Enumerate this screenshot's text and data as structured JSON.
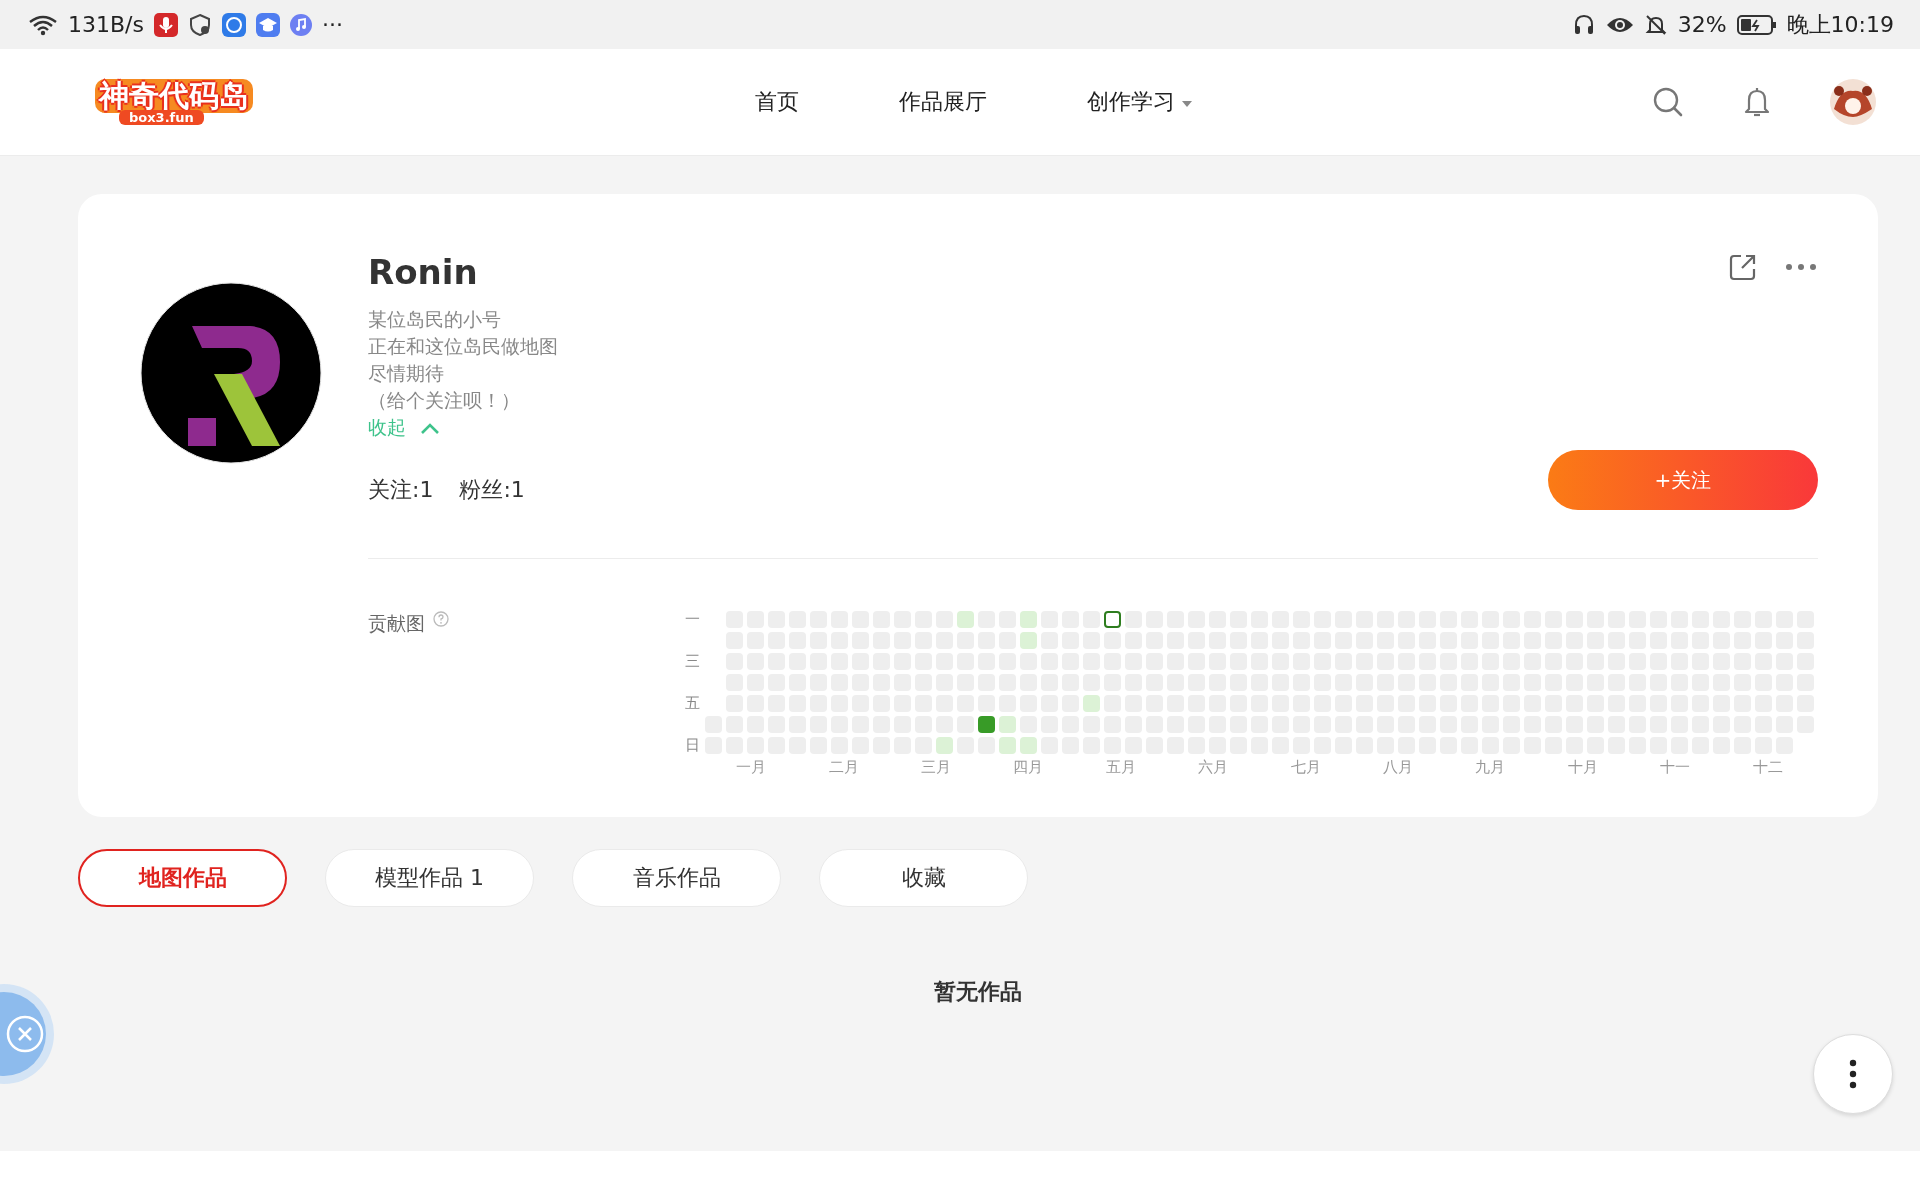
{
  "status_bar": {
    "net_speed": "131B/s",
    "more": "···",
    "battery": "32%",
    "time": "晚上10:19"
  },
  "header": {
    "logo": {
      "title": "神奇代码岛",
      "subtitle": "box3.fun"
    },
    "nav": [
      {
        "label": "首页",
        "dropdown": false
      },
      {
        "label": "作品展厅",
        "dropdown": false
      },
      {
        "label": "创作学习",
        "dropdown": true
      }
    ]
  },
  "profile": {
    "name": "Ronin",
    "bio": [
      "某位岛民的小号",
      "正在和这位岛民做地图",
      "尽情期待",
      "（给个关注呗！）"
    ],
    "toggle": "收起",
    "expanded": true,
    "stats": [
      {
        "label": "关注:1"
      },
      {
        "label": "粉丝:1"
      }
    ],
    "follow_button": "+关注"
  },
  "contribution": {
    "title": "贡献图",
    "day_labels": [
      "一",
      "三",
      "五",
      "日"
    ],
    "months": [
      "一月",
      "二月",
      "三月",
      "四月",
      "五月",
      "六月",
      "七月",
      "八月",
      "九月",
      "十月",
      "十一",
      "十二"
    ],
    "weeks": [
      {
        "days": [
          {
            "color": "#eeeeee",
            "today": false
          },
          {
            "color": "#eeeeee",
            "today": false
          }
        ]
      },
      {
        "days": [
          {
            "color": "#eeeeee",
            "today": false
          },
          {
            "color": "#eeeeee",
            "today": false
          },
          {
            "color": "#eeeeee",
            "today": false
          },
          {
            "color": "#eeeeee",
            "today": false
          },
          {
            "color": "#eeeeee",
            "today": false
          },
          {
            "color": "#eeeeee",
            "today": false
          },
          {
            "color": "#eeeeee",
            "today": false
          }
        ]
      },
      {
        "days": [
          {
            "color": "#eeeeee",
            "today": false
          },
          {
            "color": "#eeeeee",
            "today": false
          },
          {
            "color": "#eeeeee",
            "today": false
          },
          {
            "color": "#eeeeee",
            "today": false
          },
          {
            "color": "#eeeeee",
            "today": false
          },
          {
            "color": "#eeeeee",
            "today": false
          },
          {
            "color": "#eeeeee",
            "today": false
          }
        ]
      },
      {
        "days": [
          {
            "color": "#eeeeee",
            "today": false
          },
          {
            "color": "#eeeeee",
            "today": false
          },
          {
            "color": "#eeeeee",
            "today": false
          },
          {
            "color": "#eeeeee",
            "today": false
          },
          {
            "color": "#eeeeee",
            "today": false
          },
          {
            "color": "#eeeeee",
            "today": false
          },
          {
            "color": "#eeeeee",
            "today": false
          }
        ]
      },
      {
        "days": [
          {
            "color": "#eeeeee",
            "today": false
          },
          {
            "color": "#eeeeee",
            "today": false
          },
          {
            "color": "#eeeeee",
            "today": false
          },
          {
            "color": "#eeeeee",
            "today": false
          },
          {
            "color": "#eeeeee",
            "today": false
          },
          {
            "color": "#eeeeee",
            "today": false
          },
          {
            "color": "#eeeeee",
            "today": false
          }
        ]
      },
      {
        "days": [
          {
            "color": "#eeeeee",
            "today": false
          },
          {
            "color": "#eeeeee",
            "today": false
          },
          {
            "color": "#eeeeee",
            "today": false
          },
          {
            "color": "#eeeeee",
            "today": false
          },
          {
            "color": "#eeeeee",
            "today": false
          },
          {
            "color": "#eeeeee",
            "today": false
          },
          {
            "color": "#eeeeee",
            "today": false
          }
        ]
      },
      {
        "days": [
          {
            "color": "#eeeeee",
            "today": false
          },
          {
            "color": "#eeeeee",
            "today": false
          },
          {
            "color": "#eeeeee",
            "today": false
          },
          {
            "color": "#eeeeee",
            "today": false
          },
          {
            "color": "#eeeeee",
            "today": false
          },
          {
            "color": "#eeeeee",
            "today": false
          },
          {
            "color": "#eeeeee",
            "today": false
          }
        ]
      },
      {
        "days": [
          {
            "color": "#eeeeee",
            "today": false
          },
          {
            "color": "#eeeeee",
            "today": false
          },
          {
            "color": "#eeeeee",
            "today": false
          },
          {
            "color": "#eeeeee",
            "today": false
          },
          {
            "color": "#eeeeee",
            "today": false
          },
          {
            "color": "#eeeeee",
            "today": false
          },
          {
            "color": "#eeeeee",
            "today": false
          }
        ]
      },
      {
        "days": [
          {
            "color": "#eeeeee",
            "today": false
          },
          {
            "color": "#eeeeee",
            "today": false
          },
          {
            "color": "#eeeeee",
            "today": false
          },
          {
            "color": "#eeeeee",
            "today": false
          },
          {
            "color": "#eeeeee",
            "today": false
          },
          {
            "color": "#eeeeee",
            "today": false
          },
          {
            "color": "#eeeeee",
            "today": false
          }
        ]
      },
      {
        "days": [
          {
            "color": "#eeeeee",
            "today": false
          },
          {
            "color": "#eeeeee",
            "today": false
          },
          {
            "color": "#eeeeee",
            "today": false
          },
          {
            "color": "#eeeeee",
            "today": false
          },
          {
            "color": "#eeeeee",
            "today": false
          },
          {
            "color": "#eeeeee",
            "today": false
          },
          {
            "color": "#eeeeee",
            "today": false
          }
        ]
      },
      {
        "days": [
          {
            "color": "#eeeeee",
            "today": false
          },
          {
            "color": "#eeeeee",
            "today": false
          },
          {
            "color": "#eeeeee",
            "today": false
          },
          {
            "color": "#eeeeee",
            "today": false
          },
          {
            "color": "#eeeeee",
            "today": false
          },
          {
            "color": "#eeeeee",
            "today": false
          },
          {
            "color": "#eeeeee",
            "today": false
          }
        ]
      },
      {
        "days": [
          {
            "color": "#eeeeee",
            "today": false
          },
          {
            "color": "#eeeeee",
            "today": false
          },
          {
            "color": "#eeeeee",
            "today": false
          },
          {
            "color": "#eeeeee",
            "today": false
          },
          {
            "color": "#eeeeee",
            "today": false
          },
          {
            "color": "#eeeeee",
            "today": false
          },
          {
            "color": "#dcf2d6",
            "today": false
          }
        ]
      },
      {
        "days": [
          {
            "color": "#dcf2d6",
            "today": false
          },
          {
            "color": "#eeeeee",
            "today": false
          },
          {
            "color": "#eeeeee",
            "today": false
          },
          {
            "color": "#eeeeee",
            "today": false
          },
          {
            "color": "#eeeeee",
            "today": false
          },
          {
            "color": "#eeeeee",
            "today": false
          },
          {
            "color": "#eeeeee",
            "today": false
          }
        ]
      },
      {
        "days": [
          {
            "color": "#eeeeee",
            "today": false
          },
          {
            "color": "#eeeeee",
            "today": false
          },
          {
            "color": "#eeeeee",
            "today": false
          },
          {
            "color": "#eeeeee",
            "today": false
          },
          {
            "color": "#eeeeee",
            "today": false
          },
          {
            "color": "#389b27",
            "today": false
          },
          {
            "color": "#eeeeee",
            "today": false
          }
        ]
      },
      {
        "days": [
          {
            "color": "#eeeeee",
            "today": false
          },
          {
            "color": "#eeeeee",
            "today": false
          },
          {
            "color": "#eeeeee",
            "today": false
          },
          {
            "color": "#eeeeee",
            "today": false
          },
          {
            "color": "#eeeeee",
            "today": false
          },
          {
            "color": "#dcf2d6",
            "today": false
          },
          {
            "color": "#dcf2d6",
            "today": false
          }
        ]
      },
      {
        "days": [
          {
            "color": "#dcf2d6",
            "today": false
          },
          {
            "color": "#dcf2d6",
            "today": false
          },
          {
            "color": "#eeeeee",
            "today": false
          },
          {
            "color": "#eeeeee",
            "today": false
          },
          {
            "color": "#eeeeee",
            "today": false
          },
          {
            "color": "#eeeeee",
            "today": false
          },
          {
            "color": "#dcf2d6",
            "today": false
          }
        ]
      },
      {
        "days": [
          {
            "color": "#eeeeee",
            "today": false
          },
          {
            "color": "#eeeeee",
            "today": false
          },
          {
            "color": "#eeeeee",
            "today": false
          },
          {
            "color": "#eeeeee",
            "today": false
          },
          {
            "color": "#eeeeee",
            "today": false
          },
          {
            "color": "#eeeeee",
            "today": false
          },
          {
            "color": "#eeeeee",
            "today": false
          }
        ]
      },
      {
        "days": [
          {
            "color": "#eeeeee",
            "today": false
          },
          {
            "color": "#eeeeee",
            "today": false
          },
          {
            "color": "#eeeeee",
            "today": false
          },
          {
            "color": "#eeeeee",
            "today": false
          },
          {
            "color": "#eeeeee",
            "today": false
          },
          {
            "color": "#eeeeee",
            "today": false
          },
          {
            "color": "#eeeeee",
            "today": false
          }
        ]
      },
      {
        "days": [
          {
            "color": "#eeeeee",
            "today": false
          },
          {
            "color": "#eeeeee",
            "today": false
          },
          {
            "color": "#eeeeee",
            "today": false
          },
          {
            "color": "#eeeeee",
            "today": false
          },
          {
            "color": "#dcf2d6",
            "today": false
          },
          {
            "color": "#eeeeee",
            "today": false
          },
          {
            "color": "#eeeeee",
            "today": false
          }
        ]
      },
      {
        "days": [
          {
            "color": "#ffffff",
            "today": true
          },
          {
            "color": "#eeeeee",
            "today": false
          },
          {
            "color": "#eeeeee",
            "today": false
          },
          {
            "color": "#eeeeee",
            "today": false
          },
          {
            "color": "#eeeeee",
            "today": false
          },
          {
            "color": "#eeeeee",
            "today": false
          },
          {
            "color": "#eeeeee",
            "today": false
          }
        ]
      },
      {
        "days": [
          {
            "color": "#eeeeee",
            "today": false
          },
          {
            "color": "#eeeeee",
            "today": false
          },
          {
            "color": "#eeeeee",
            "today": false
          },
          {
            "color": "#eeeeee",
            "today": false
          },
          {
            "color": "#eeeeee",
            "today": false
          },
          {
            "color": "#eeeeee",
            "today": false
          },
          {
            "color": "#eeeeee",
            "today": false
          }
        ]
      },
      {
        "days": [
          {
            "color": "#eeeeee",
            "today": false
          },
          {
            "color": "#eeeeee",
            "today": false
          },
          {
            "color": "#eeeeee",
            "today": false
          },
          {
            "color": "#eeeeee",
            "today": false
          },
          {
            "color": "#eeeeee",
            "today": false
          },
          {
            "color": "#eeeeee",
            "today": false
          },
          {
            "color": "#eeeeee",
            "today": false
          }
        ]
      },
      {
        "days": [
          {
            "color": "#eeeeee",
            "today": false
          },
          {
            "color": "#eeeeee",
            "today": false
          },
          {
            "color": "#eeeeee",
            "today": false
          },
          {
            "color": "#eeeeee",
            "today": false
          },
          {
            "color": "#eeeeee",
            "today": false
          },
          {
            "color": "#eeeeee",
            "today": false
          },
          {
            "color": "#eeeeee",
            "today": false
          }
        ]
      },
      {
        "days": [
          {
            "color": "#eeeeee",
            "today": false
          },
          {
            "color": "#eeeeee",
            "today": false
          },
          {
            "color": "#eeeeee",
            "today": false
          },
          {
            "color": "#eeeeee",
            "today": false
          },
          {
            "color": "#eeeeee",
            "today": false
          },
          {
            "color": "#eeeeee",
            "today": false
          },
          {
            "color": "#eeeeee",
            "today": false
          }
        ]
      },
      {
        "days": [
          {
            "color": "#eeeeee",
            "today": false
          },
          {
            "color": "#eeeeee",
            "today": false
          },
          {
            "color": "#eeeeee",
            "today": false
          },
          {
            "color": "#eeeeee",
            "today": false
          },
          {
            "color": "#eeeeee",
            "today": false
          },
          {
            "color": "#eeeeee",
            "today": false
          },
          {
            "color": "#eeeeee",
            "today": false
          }
        ]
      },
      {
        "days": [
          {
            "color": "#eeeeee",
            "today": false
          },
          {
            "color": "#eeeeee",
            "today": false
          },
          {
            "color": "#eeeeee",
            "today": false
          },
          {
            "color": "#eeeeee",
            "today": false
          },
          {
            "color": "#eeeeee",
            "today": false
          },
          {
            "color": "#eeeeee",
            "today": false
          },
          {
            "color": "#eeeeee",
            "today": false
          }
        ]
      },
      {
        "days": [
          {
            "color": "#eeeeee",
            "today": false
          },
          {
            "color": "#eeeeee",
            "today": false
          },
          {
            "color": "#eeeeee",
            "today": false
          },
          {
            "color": "#eeeeee",
            "today": false
          },
          {
            "color": "#eeeeee",
            "today": false
          },
          {
            "color": "#eeeeee",
            "today": false
          },
          {
            "color": "#eeeeee",
            "today": false
          }
        ]
      },
      {
        "days": [
          {
            "color": "#eeeeee",
            "today": false
          },
          {
            "color": "#eeeeee",
            "today": false
          },
          {
            "color": "#eeeeee",
            "today": false
          },
          {
            "color": "#eeeeee",
            "today": false
          },
          {
            "color": "#eeeeee",
            "today": false
          },
          {
            "color": "#eeeeee",
            "today": false
          },
          {
            "color": "#eeeeee",
            "today": false
          }
        ]
      },
      {
        "days": [
          {
            "color": "#eeeeee",
            "today": false
          },
          {
            "color": "#eeeeee",
            "today": false
          },
          {
            "color": "#eeeeee",
            "today": false
          },
          {
            "color": "#eeeeee",
            "today": false
          },
          {
            "color": "#eeeeee",
            "today": false
          },
          {
            "color": "#eeeeee",
            "today": false
          },
          {
            "color": "#eeeeee",
            "today": false
          }
        ]
      },
      {
        "days": [
          {
            "color": "#eeeeee",
            "today": false
          },
          {
            "color": "#eeeeee",
            "today": false
          },
          {
            "color": "#eeeeee",
            "today": false
          },
          {
            "color": "#eeeeee",
            "today": false
          },
          {
            "color": "#eeeeee",
            "today": false
          },
          {
            "color": "#eeeeee",
            "today": false
          },
          {
            "color": "#eeeeee",
            "today": false
          }
        ]
      },
      {
        "days": [
          {
            "color": "#eeeeee",
            "today": false
          },
          {
            "color": "#eeeeee",
            "today": false
          },
          {
            "color": "#eeeeee",
            "today": false
          },
          {
            "color": "#eeeeee",
            "today": false
          },
          {
            "color": "#eeeeee",
            "today": false
          },
          {
            "color": "#eeeeee",
            "today": false
          },
          {
            "color": "#eeeeee",
            "today": false
          }
        ]
      },
      {
        "days": [
          {
            "color": "#eeeeee",
            "today": false
          },
          {
            "color": "#eeeeee",
            "today": false
          },
          {
            "color": "#eeeeee",
            "today": false
          },
          {
            "color": "#eeeeee",
            "today": false
          },
          {
            "color": "#eeeeee",
            "today": false
          },
          {
            "color": "#eeeeee",
            "today": false
          },
          {
            "color": "#eeeeee",
            "today": false
          }
        ]
      },
      {
        "days": [
          {
            "color": "#eeeeee",
            "today": false
          },
          {
            "color": "#eeeeee",
            "today": false
          },
          {
            "color": "#eeeeee",
            "today": false
          },
          {
            "color": "#eeeeee",
            "today": false
          },
          {
            "color": "#eeeeee",
            "today": false
          },
          {
            "color": "#eeeeee",
            "today": false
          },
          {
            "color": "#eeeeee",
            "today": false
          }
        ]
      },
      {
        "days": [
          {
            "color": "#eeeeee",
            "today": false
          },
          {
            "color": "#eeeeee",
            "today": false
          },
          {
            "color": "#eeeeee",
            "today": false
          },
          {
            "color": "#eeeeee",
            "today": false
          },
          {
            "color": "#eeeeee",
            "today": false
          },
          {
            "color": "#eeeeee",
            "today": false
          },
          {
            "color": "#eeeeee",
            "today": false
          }
        ]
      },
      {
        "days": [
          {
            "color": "#eeeeee",
            "today": false
          },
          {
            "color": "#eeeeee",
            "today": false
          },
          {
            "color": "#eeeeee",
            "today": false
          },
          {
            "color": "#eeeeee",
            "today": false
          },
          {
            "color": "#eeeeee",
            "today": false
          },
          {
            "color": "#eeeeee",
            "today": false
          },
          {
            "color": "#eeeeee",
            "today": false
          }
        ]
      },
      {
        "days": [
          {
            "color": "#eeeeee",
            "today": false
          },
          {
            "color": "#eeeeee",
            "today": false
          },
          {
            "color": "#eeeeee",
            "today": false
          },
          {
            "color": "#eeeeee",
            "today": false
          },
          {
            "color": "#eeeeee",
            "today": false
          },
          {
            "color": "#eeeeee",
            "today": false
          },
          {
            "color": "#eeeeee",
            "today": false
          }
        ]
      },
      {
        "days": [
          {
            "color": "#eeeeee",
            "today": false
          },
          {
            "color": "#eeeeee",
            "today": false
          },
          {
            "color": "#eeeeee",
            "today": false
          },
          {
            "color": "#eeeeee",
            "today": false
          },
          {
            "color": "#eeeeee",
            "today": false
          },
          {
            "color": "#eeeeee",
            "today": false
          },
          {
            "color": "#eeeeee",
            "today": false
          }
        ]
      },
      {
        "days": [
          {
            "color": "#eeeeee",
            "today": false
          },
          {
            "color": "#eeeeee",
            "today": false
          },
          {
            "color": "#eeeeee",
            "today": false
          },
          {
            "color": "#eeeeee",
            "today": false
          },
          {
            "color": "#eeeeee",
            "today": false
          },
          {
            "color": "#eeeeee",
            "today": false
          },
          {
            "color": "#eeeeee",
            "today": false
          }
        ]
      },
      {
        "days": [
          {
            "color": "#eeeeee",
            "today": false
          },
          {
            "color": "#eeeeee",
            "today": false
          },
          {
            "color": "#eeeeee",
            "today": false
          },
          {
            "color": "#eeeeee",
            "today": false
          },
          {
            "color": "#eeeeee",
            "today": false
          },
          {
            "color": "#eeeeee",
            "today": false
          },
          {
            "color": "#eeeeee",
            "today": false
          }
        ]
      },
      {
        "days": [
          {
            "color": "#eeeeee",
            "today": false
          },
          {
            "color": "#eeeeee",
            "today": false
          },
          {
            "color": "#eeeeee",
            "today": false
          },
          {
            "color": "#eeeeee",
            "today": false
          },
          {
            "color": "#eeeeee",
            "today": false
          },
          {
            "color": "#eeeeee",
            "today": false
          },
          {
            "color": "#eeeeee",
            "today": false
          }
        ]
      },
      {
        "days": [
          {
            "color": "#eeeeee",
            "today": false
          },
          {
            "color": "#eeeeee",
            "today": false
          },
          {
            "color": "#eeeeee",
            "today": false
          },
          {
            "color": "#eeeeee",
            "today": false
          },
          {
            "color": "#eeeeee",
            "today": false
          },
          {
            "color": "#eeeeee",
            "today": false
          },
          {
            "color": "#eeeeee",
            "today": false
          }
        ]
      },
      {
        "days": [
          {
            "color": "#eeeeee",
            "today": false
          },
          {
            "color": "#eeeeee",
            "today": false
          },
          {
            "color": "#eeeeee",
            "today": false
          },
          {
            "color": "#eeeeee",
            "today": false
          },
          {
            "color": "#eeeeee",
            "today": false
          },
          {
            "color": "#eeeeee",
            "today": false
          },
          {
            "color": "#eeeeee",
            "today": false
          }
        ]
      },
      {
        "days": [
          {
            "color": "#eeeeee",
            "today": false
          },
          {
            "color": "#eeeeee",
            "today": false
          },
          {
            "color": "#eeeeee",
            "today": false
          },
          {
            "color": "#eeeeee",
            "today": false
          },
          {
            "color": "#eeeeee",
            "today": false
          },
          {
            "color": "#eeeeee",
            "today": false
          },
          {
            "color": "#eeeeee",
            "today": false
          }
        ]
      },
      {
        "days": [
          {
            "color": "#eeeeee",
            "today": false
          },
          {
            "color": "#eeeeee",
            "today": false
          },
          {
            "color": "#eeeeee",
            "today": false
          },
          {
            "color": "#eeeeee",
            "today": false
          },
          {
            "color": "#eeeeee",
            "today": false
          },
          {
            "color": "#eeeeee",
            "today": false
          },
          {
            "color": "#eeeeee",
            "today": false
          }
        ]
      },
      {
        "days": [
          {
            "color": "#eeeeee",
            "today": false
          },
          {
            "color": "#eeeeee",
            "today": false
          },
          {
            "color": "#eeeeee",
            "today": false
          },
          {
            "color": "#eeeeee",
            "today": false
          },
          {
            "color": "#eeeeee",
            "today": false
          },
          {
            "color": "#eeeeee",
            "today": false
          },
          {
            "color": "#eeeeee",
            "today": false
          }
        ]
      },
      {
        "days": [
          {
            "color": "#eeeeee",
            "today": false
          },
          {
            "color": "#eeeeee",
            "today": false
          },
          {
            "color": "#eeeeee",
            "today": false
          },
          {
            "color": "#eeeeee",
            "today": false
          },
          {
            "color": "#eeeeee",
            "today": false
          },
          {
            "color": "#eeeeee",
            "today": false
          },
          {
            "color": "#eeeeee",
            "today": false
          }
        ]
      },
      {
        "days": [
          {
            "color": "#eeeeee",
            "today": false
          },
          {
            "color": "#eeeeee",
            "today": false
          },
          {
            "color": "#eeeeee",
            "today": false
          },
          {
            "color": "#eeeeee",
            "today": false
          },
          {
            "color": "#eeeeee",
            "today": false
          },
          {
            "color": "#eeeeee",
            "today": false
          },
          {
            "color": "#eeeeee",
            "today": false
          }
        ]
      },
      {
        "days": [
          {
            "color": "#eeeeee",
            "today": false
          },
          {
            "color": "#eeeeee",
            "today": false
          },
          {
            "color": "#eeeeee",
            "today": false
          },
          {
            "color": "#eeeeee",
            "today": false
          },
          {
            "color": "#eeeeee",
            "today": false
          },
          {
            "color": "#eeeeee",
            "today": false
          },
          {
            "color": "#eeeeee",
            "today": false
          }
        ]
      },
      {
        "days": [
          {
            "color": "#eeeeee",
            "today": false
          },
          {
            "color": "#eeeeee",
            "today": false
          },
          {
            "color": "#eeeeee",
            "today": false
          },
          {
            "color": "#eeeeee",
            "today": false
          },
          {
            "color": "#eeeeee",
            "today": false
          },
          {
            "color": "#eeeeee",
            "today": false
          },
          {
            "color": "#eeeeee",
            "today": false
          }
        ]
      },
      {
        "days": [
          {
            "color": "#eeeeee",
            "today": false
          },
          {
            "color": "#eeeeee",
            "today": false
          },
          {
            "color": "#eeeeee",
            "today": false
          },
          {
            "color": "#eeeeee",
            "today": false
          },
          {
            "color": "#eeeeee",
            "today": false
          },
          {
            "color": "#eeeeee",
            "today": false
          },
          {
            "color": "#eeeeee",
            "today": false
          }
        ]
      },
      {
        "days": [
          {
            "color": "#eeeeee",
            "today": false
          },
          {
            "color": "#eeeeee",
            "today": false
          },
          {
            "color": "#eeeeee",
            "today": false
          },
          {
            "color": "#eeeeee",
            "today": false
          },
          {
            "color": "#eeeeee",
            "today": false
          },
          {
            "color": "#eeeeee",
            "today": false
          },
          {
            "color": "#eeeeee",
            "today": false
          }
        ]
      },
      {
        "days": [
          {
            "color": "#eeeeee",
            "today": false
          },
          {
            "color": "#eeeeee",
            "today": false
          },
          {
            "color": "#eeeeee",
            "today": false
          },
          {
            "color": "#eeeeee",
            "today": false
          },
          {
            "color": "#eeeeee",
            "today": false
          },
          {
            "color": "#eeeeee",
            "today": false
          },
          {
            "color": "#eeeeee",
            "today": false
          }
        ]
      },
      {
        "days": [
          {
            "color": "#eeeeee",
            "today": false
          },
          {
            "color": "#eeeeee",
            "today": false
          },
          {
            "color": "#eeeeee",
            "today": false
          },
          {
            "color": "#eeeeee",
            "today": false
          },
          {
            "color": "#eeeeee",
            "today": false
          },
          {
            "color": "#eeeeee",
            "today": false
          }
        ]
      }
    ]
  },
  "tabs": [
    {
      "label": "地图作品",
      "selected": true
    },
    {
      "label": "模型作品 1",
      "selected": false
    },
    {
      "label": "音乐作品",
      "selected": false
    },
    {
      "label": "收藏",
      "selected": false
    }
  ],
  "empty_message": "暂无作品"
}
